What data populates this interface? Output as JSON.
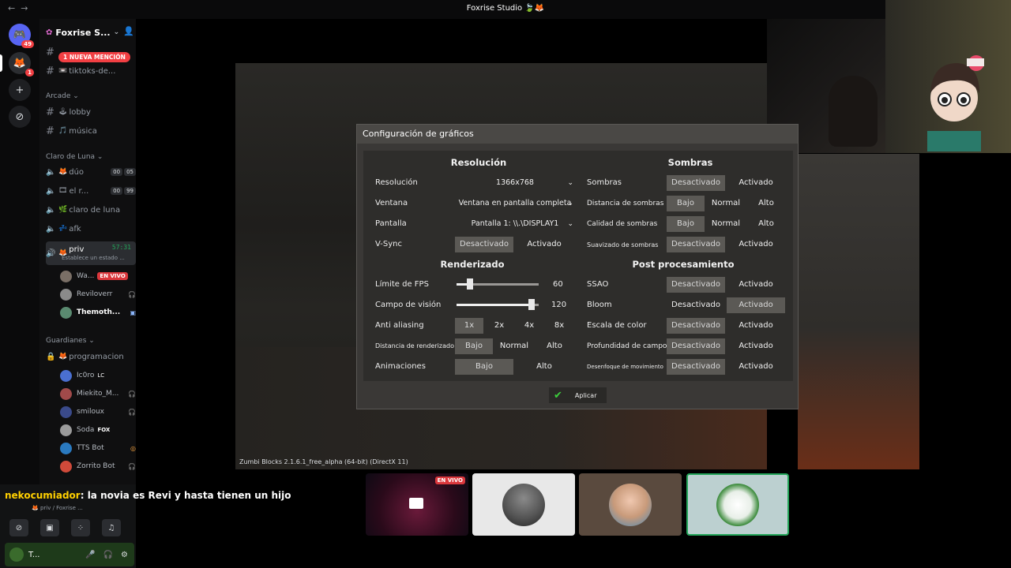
{
  "window": {
    "title": "Foxrise Studio 🍃🦊",
    "nav_back": "←",
    "nav_fwd": "→"
  },
  "rail": {
    "dm_badge": "49",
    "server_badge": "1",
    "add": "+",
    "discover": "⊘"
  },
  "server": {
    "name": "Foxrise S...",
    "mention_pill": "1 NUEVA MENCIÓN",
    "channels_top": [
      {
        "label": "tiktoks-de..."
      }
    ],
    "category_arcade": "Arcade",
    "arcade": [
      {
        "emoji": "🕹",
        "label": "lobby"
      },
      {
        "emoji": "🎵",
        "label": "música"
      }
    ],
    "category_luna": "Claro de Luna",
    "luna": [
      {
        "emoji": "🦊",
        "label": "dúo",
        "c1": "00",
        "c2": "05"
      },
      {
        "emoji": "🎞",
        "label": "el r...",
        "c1": "00",
        "c2": "99"
      },
      {
        "emoji": "🌿",
        "label": "claro de luna"
      },
      {
        "emoji": "💤",
        "label": "afk"
      }
    ],
    "active": {
      "emoji": "🦊",
      "label": "priv",
      "time": "57:31",
      "status": "Establece un estado ..."
    },
    "voice_users": [
      {
        "name": "Wa...",
        "badge": "EN VIVO"
      },
      {
        "name": "Reviloverr"
      },
      {
        "name": "Themoth..."
      }
    ],
    "category_guard": "Guardianes",
    "guard_channel": {
      "emoji": "🦊",
      "label": "programacion"
    },
    "guard_users": [
      {
        "name": "Ic0ro",
        "tag": "LC"
      },
      {
        "name": "Miekito_M..."
      },
      {
        "name": "smiloux"
      },
      {
        "name": "Soda",
        "tag": "FOX"
      },
      {
        "name": "TTS Bot"
      },
      {
        "name": "Zorrito Bot"
      }
    ]
  },
  "panel": {
    "voice_info": "🦊 priv / Foxrise ...",
    "user": "T..."
  },
  "chat": {
    "user": "nekocumiador",
    "text": ": la novia es Revi y hasta tienen un hijo"
  },
  "game": {
    "version": "Zumbi Blocks 2.1.6.1_free_alpha (64-bit) (DirectX 11)"
  },
  "dialog": {
    "title": "Configuración de gráficos",
    "sections": {
      "resolucion": "Resolución",
      "sombras": "Sombras",
      "renderizado": "Renderizado",
      "post": "Post procesamiento"
    },
    "left": {
      "resolucion": {
        "label": "Resolución",
        "value": "1366x768"
      },
      "ventana": {
        "label": "Ventana",
        "value": "Ventana en pantalla completa"
      },
      "pantalla": {
        "label": "Pantalla",
        "value": "Pantalla 1: \\\\.\\DISPLAY1"
      },
      "vsync": {
        "label": "V-Sync",
        "opts": [
          "Desactivado",
          "Activado"
        ]
      },
      "fps": {
        "label": "Límite de FPS",
        "value": "60",
        "fraction": 0.14
      },
      "fov": {
        "label": "Campo de visión",
        "value": "120",
        "fraction": 0.95
      },
      "aa": {
        "label": "Anti aliasing",
        "opts": [
          "1x",
          "2x",
          "4x",
          "8x"
        ]
      },
      "dist": {
        "label": "Distancia de renderizado",
        "opts": [
          "Bajo",
          "Normal",
          "Alto"
        ]
      },
      "anim": {
        "label": "Animaciones",
        "opts": [
          "Bajo",
          "Alto"
        ]
      }
    },
    "right": {
      "sombras": {
        "label": "Sombras",
        "opts": [
          "Desactivado",
          "Activado"
        ]
      },
      "dist_sombras": {
        "label": "Distancia de sombras",
        "opts": [
          "Bajo",
          "Normal",
          "Alto"
        ]
      },
      "calidad_sombras": {
        "label": "Calidad de sombras",
        "opts": [
          "Bajo",
          "Normal",
          "Alto"
        ]
      },
      "suavizado": {
        "label": "Suavizado de sombras",
        "opts": [
          "Desactivado",
          "Activado"
        ]
      },
      "ssao": {
        "label": "SSAO",
        "opts": [
          "Desactivado",
          "Activado"
        ]
      },
      "bloom": {
        "label": "Bloom",
        "opts": [
          "Desactivado",
          "Activado"
        ]
      },
      "escala": {
        "label": "Escala de color",
        "opts": [
          "Desactivado",
          "Activado"
        ]
      },
      "profundidad": {
        "label": "Profundidad de campo",
        "opts": [
          "Desactivado",
          "Activado"
        ]
      },
      "desenfoque": {
        "label": "Desenfoque de movimiento",
        "opts": [
          "Desactivado",
          "Activado"
        ]
      }
    },
    "apply": "Aplicar"
  },
  "tiles": {
    "live_badge": "EN VIVO"
  }
}
